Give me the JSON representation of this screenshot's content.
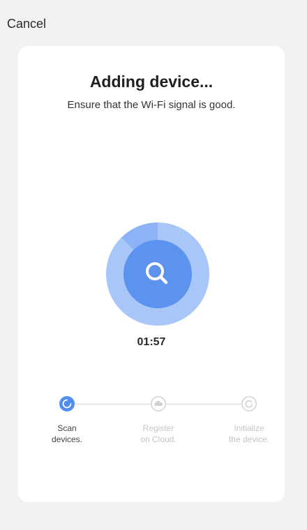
{
  "header": {
    "cancel_label": "Cancel"
  },
  "main": {
    "title": "Adding device...",
    "subtitle": "Ensure that the Wi-Fi signal is good.",
    "timer": "01:57",
    "radar_icon": "search-icon"
  },
  "steps": [
    {
      "line1": "Scan",
      "line2": "devices.",
      "icon": "progress-spinner-icon",
      "state": "active"
    },
    {
      "line1": "Register",
      "line2": "on Cloud.",
      "icon": "cloud-icon",
      "state": "pending"
    },
    {
      "line1": "Initialize",
      "line2": "the device.",
      "icon": "refresh-icon",
      "state": "pending"
    }
  ],
  "colors": {
    "accent": "#4f8ef0",
    "radar_outer": "#a9c6f8",
    "radar_sweep": "#8cb3f5",
    "radar_inner": "#5b93ee",
    "inactive": "#d0d0d0",
    "background": "#f2f2f4"
  }
}
